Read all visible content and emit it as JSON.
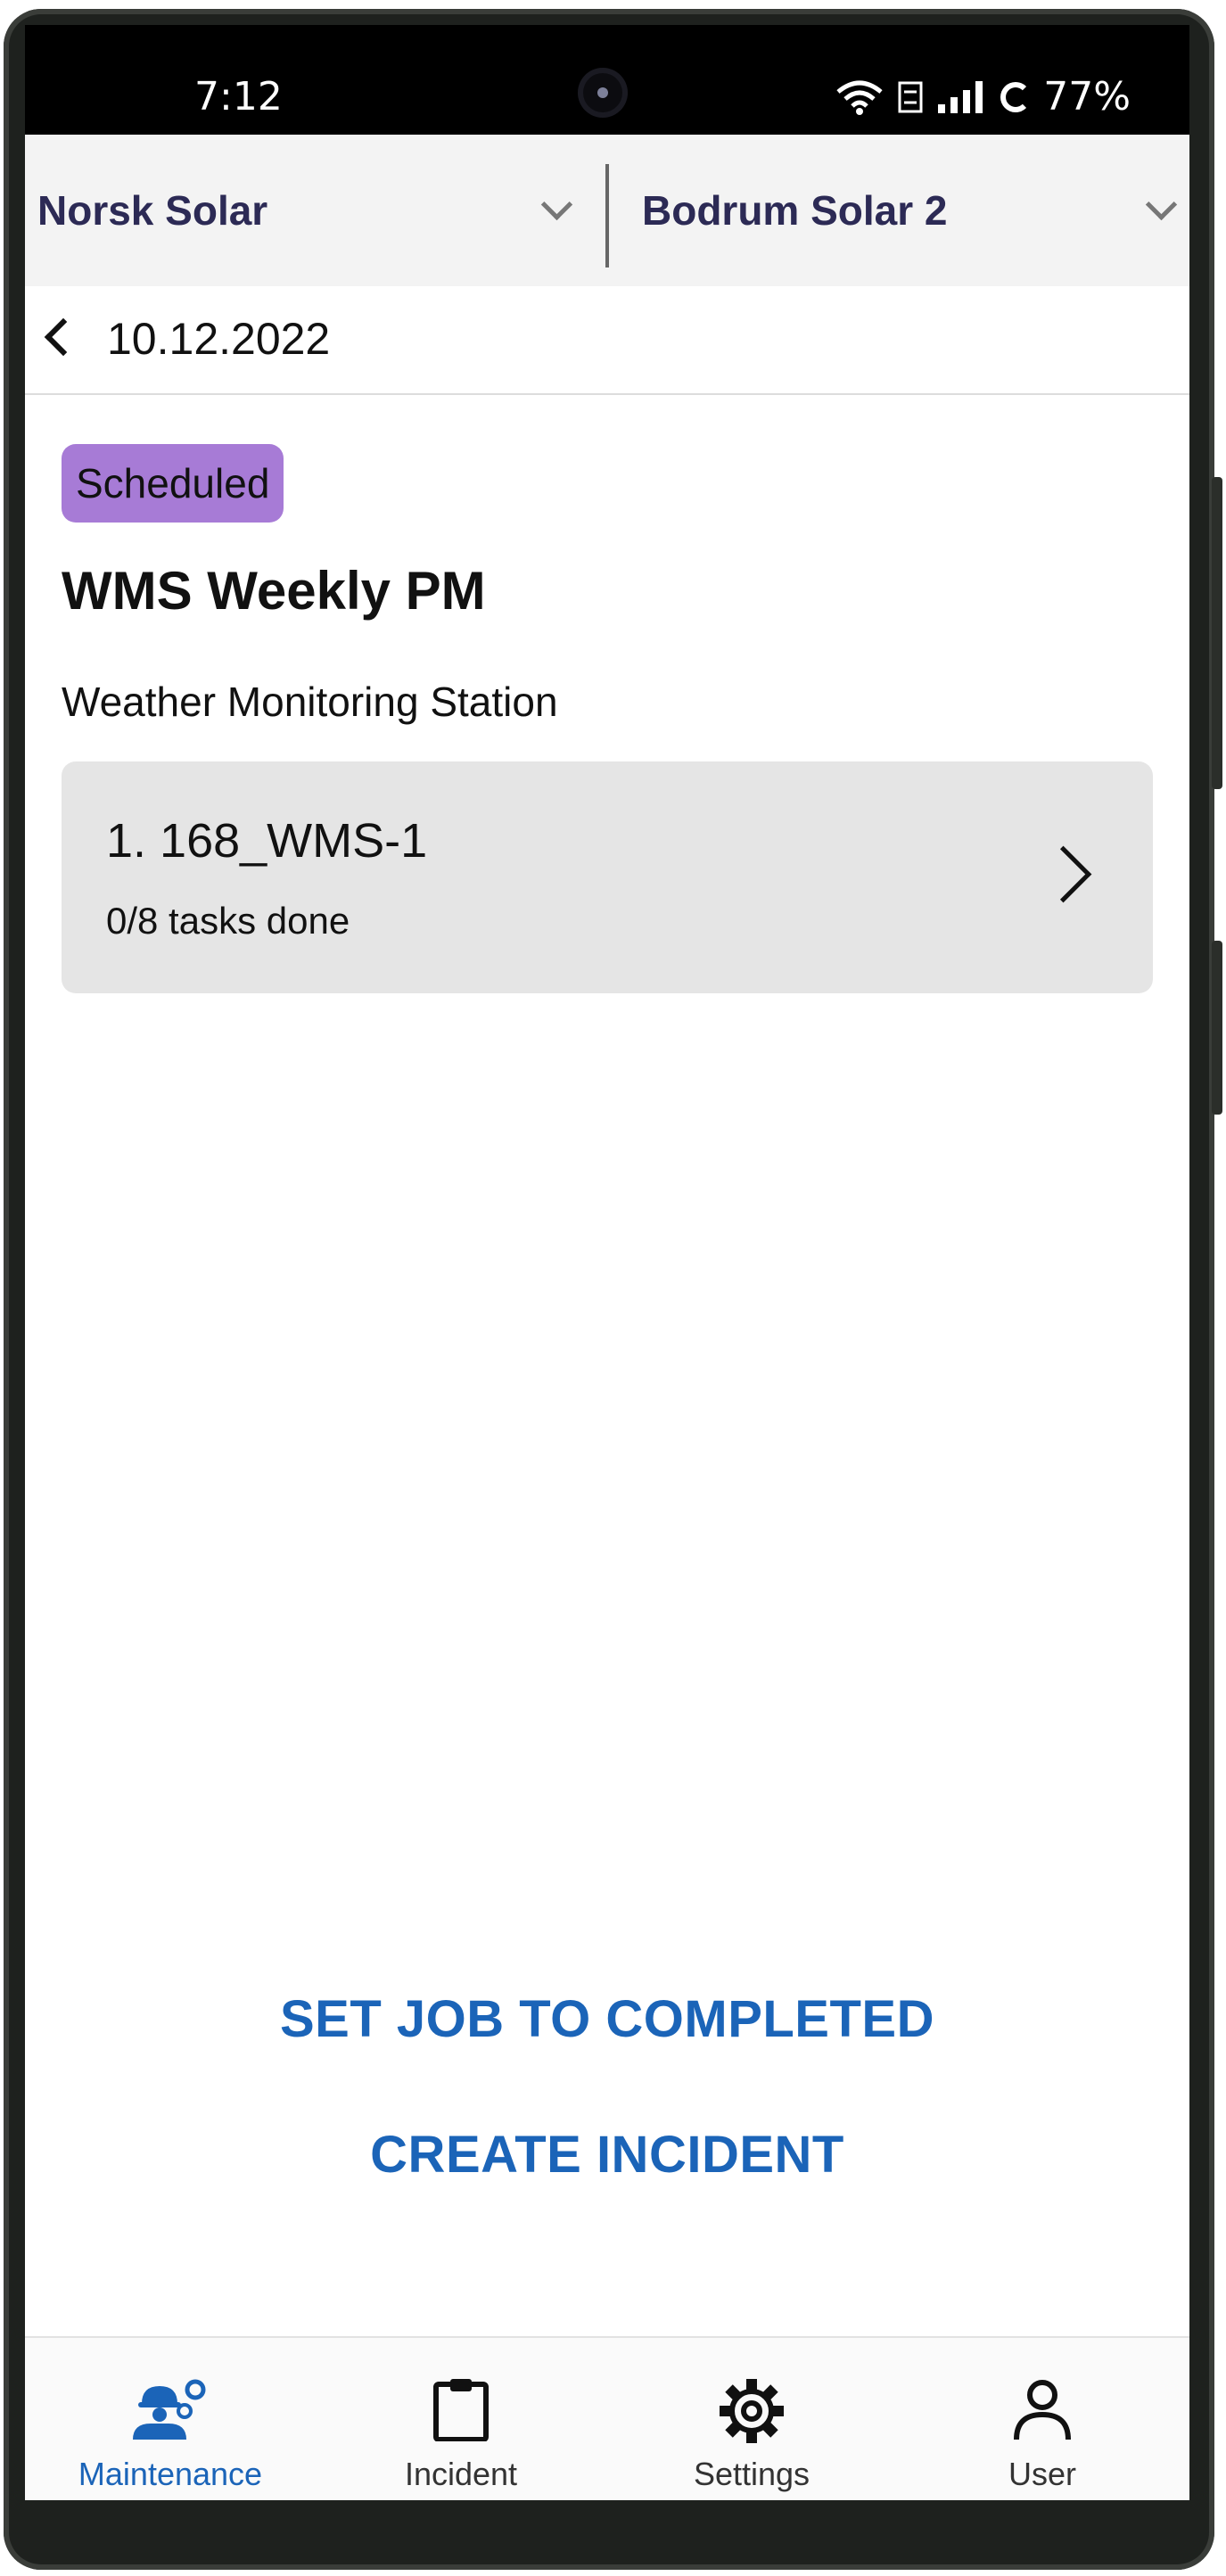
{
  "status_bar": {
    "time": "7:12",
    "battery": "77%"
  },
  "selectors": {
    "portfolio": "Norsk Solar",
    "plant": "Bodrum Solar 2"
  },
  "header": {
    "date": "10.12.2022"
  },
  "job": {
    "status": "Scheduled",
    "status_color": "#a77bd6",
    "title": "WMS Weekly PM",
    "subtitle": "Weather Monitoring Station"
  },
  "assets": [
    {
      "name": "1. 168_WMS-1",
      "progress": "0/8 tasks done"
    }
  ],
  "actions": {
    "complete": "SET JOB TO COMPLETED",
    "incident": "CREATE INCIDENT"
  },
  "nav": {
    "accent": "#1b64b8",
    "items": [
      {
        "label": "Maintenance",
        "icon": "maintenance-worker-icon",
        "active": true
      },
      {
        "label": "Incident",
        "icon": "clipboard-icon",
        "active": false
      },
      {
        "label": "Settings",
        "icon": "gear-icon",
        "active": false
      },
      {
        "label": "User",
        "icon": "user-icon",
        "active": false
      }
    ]
  }
}
